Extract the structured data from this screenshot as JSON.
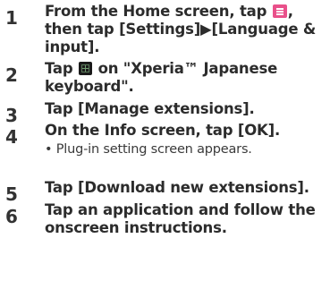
{
  "steps": [
    {
      "number": "1",
      "before": "From the Home screen, tap ",
      "icon": "menu-icon",
      "after": ", then tap [Settings]▶[Language & input]."
    },
    {
      "number": "2",
      "before": "Tap ",
      "icon": "settings-icon",
      "after": " on \"Xperia™ Japanese keyboard\"."
    },
    {
      "number": "3",
      "text": "Tap [Manage extensions]."
    },
    {
      "number": "4",
      "text": "On the Info screen, tap [OK].",
      "sub": "• Plug-in setting screen appears."
    },
    {
      "number": "5",
      "text": "Tap [Download new extensions]."
    },
    {
      "number": "6",
      "text": "Tap an application and follow the onscreen instructions."
    }
  ]
}
